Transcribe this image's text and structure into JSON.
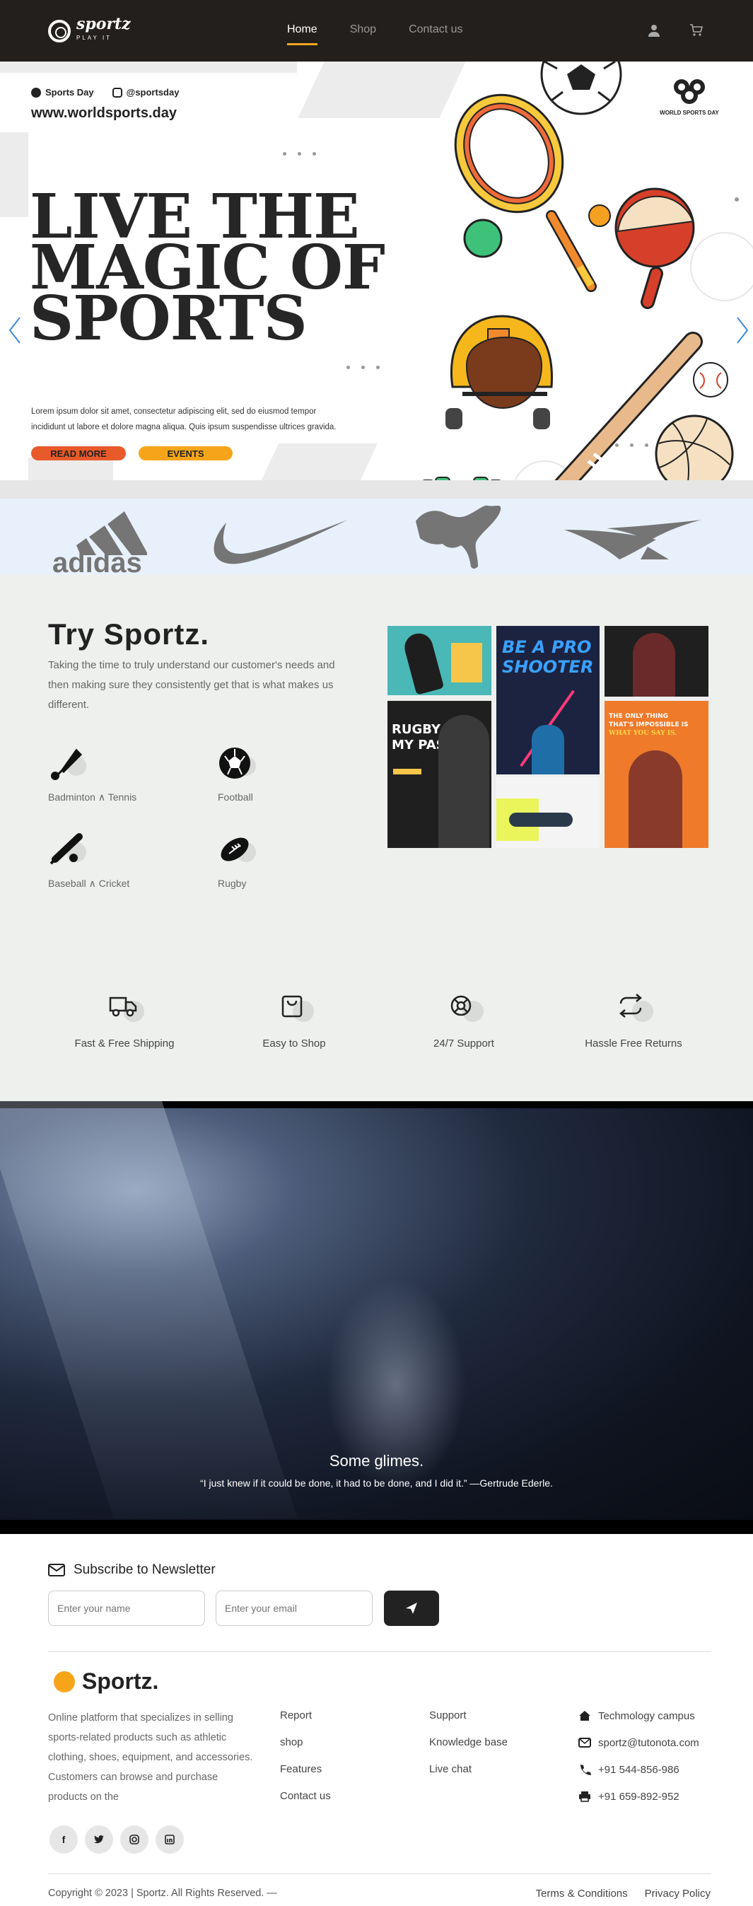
{
  "nav": {
    "logo_text": "sportz",
    "logo_tagline": "PLAY IT",
    "links": [
      "Home",
      "Shop",
      "Contact us"
    ],
    "icons": [
      "user-icon",
      "cart-icon"
    ]
  },
  "hero": {
    "social_facebook": "Sports Day",
    "social_instagram": "@sportsday",
    "website": "www.worldsports.day",
    "title_lines": [
      "LIVE THE",
      "MAGIC OF",
      "SPORTS"
    ],
    "body": "Lorem ipsum dolor sit amet, consectetur  adipiscing elit, sed do eiusmod tempor incididunt ut labore et dolore magna aliqua. Quis ipsum suspendisse ultrices gravida.",
    "btn_read_more": "READ MORE",
    "btn_events": "EVENTS",
    "badge": "WORLD SPORTS DAY",
    "colors": {
      "read_more": "#e85a2a",
      "events": "#f6a51a"
    }
  },
  "brands": [
    "adidas",
    "nike",
    "puma",
    "reebok"
  ],
  "try": {
    "title": "Try Sportz.",
    "description": "Taking the time to truly understand our customer's needs and then making sure they consistently get that is what makes us different.",
    "sports": [
      {
        "label": "Badminton ∧ Tennis",
        "icon": "shuttlecock-icon"
      },
      {
        "label": "Football",
        "icon": "soccer-ball-icon"
      },
      {
        "label": "Baseball ∧ Cricket",
        "icon": "baseball-bat-icon"
      },
      {
        "label": "Rugby",
        "icon": "rugby-ball-icon"
      }
    ],
    "collage": {
      "shooter_line1": "BE A PRO",
      "shooter_line2": "SHOOTER",
      "rugby_line1": "RUGBY IS",
      "rugby_line2": "MY PASSION!",
      "impossible_line1": "THE ONLY THING",
      "impossible_line2": "THAT'S IMPOSSIBLE IS",
      "impossible_line3": "WHAT YOU SAY IS."
    },
    "features": [
      {
        "label": "Fast & Free Shipping",
        "icon": "truck-icon"
      },
      {
        "label": "Easy to Shop",
        "icon": "shopping-bag-icon"
      },
      {
        "label": "24/7 Support",
        "icon": "lifebuoy-icon"
      },
      {
        "label": "Hassle Free Returns",
        "icon": "returns-icon"
      }
    ]
  },
  "video": {
    "title": "Some glimes.",
    "quote": "“I just knew if it could be done, it had to be done, and I did it.” —Gertrude Ederle."
  },
  "newsletter": {
    "title": "Subscribe to Newsletter",
    "name_placeholder": "Enter your name",
    "email_placeholder": "Enter your email"
  },
  "footer": {
    "brand": "Sportz.",
    "about": "Online platform that specializes in selling sports-related products such as athletic clothing, shoes, equipment, and accessories. Customers can browse and purchase products on the",
    "col1": [
      "Report",
      "shop",
      "Features",
      "Contact us"
    ],
    "col2": [
      "Support",
      "Knowledge base",
      "Live chat"
    ],
    "contact": [
      "Techmology campus",
      "sportz@tutonota.com",
      "+91 544-856-986",
      "+91 659-892-952"
    ],
    "socials": [
      "f",
      "t",
      "ig",
      "in"
    ],
    "copyright": "Copyright © 2023 | Sportz. All Rights Reserved. —",
    "terms": "Terms & Conditions",
    "privacy": "Privacy Policy"
  }
}
